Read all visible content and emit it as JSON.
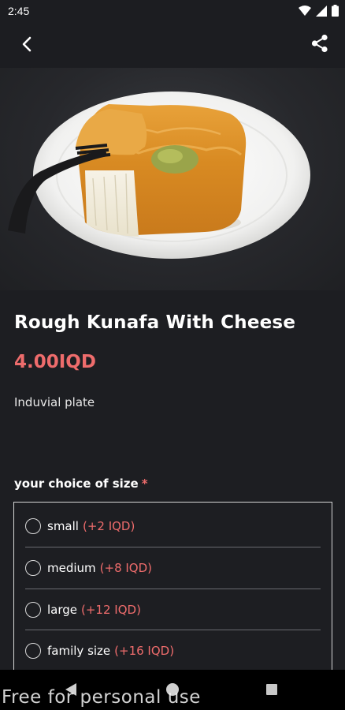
{
  "status_bar": {
    "time": "2:45"
  },
  "product": {
    "title": "Rough Kunafa With Cheese",
    "price": "4.00IQD",
    "description": "Induvial plate"
  },
  "size_section": {
    "label": "your choice of size",
    "required_marker": "*",
    "options": [
      {
        "name": "small",
        "price": "(+2 IQD)"
      },
      {
        "name": "medium",
        "price": "(+8 IQD)"
      },
      {
        "name": "large",
        "price": "(+12 IQD)"
      },
      {
        "name": "family size",
        "price": "(+16 IQD)"
      }
    ]
  },
  "watermark": "Free for personal use",
  "icons": {
    "back": "arrow-back-icon",
    "share": "share-icon",
    "expand": "expand-icon",
    "wifi": "wifi-icon",
    "signal": "signal-icon",
    "battery": "battery-icon"
  },
  "colors": {
    "accent": "#ee6c6c",
    "background": "#1d1e22",
    "border": "#d6d6d6"
  }
}
